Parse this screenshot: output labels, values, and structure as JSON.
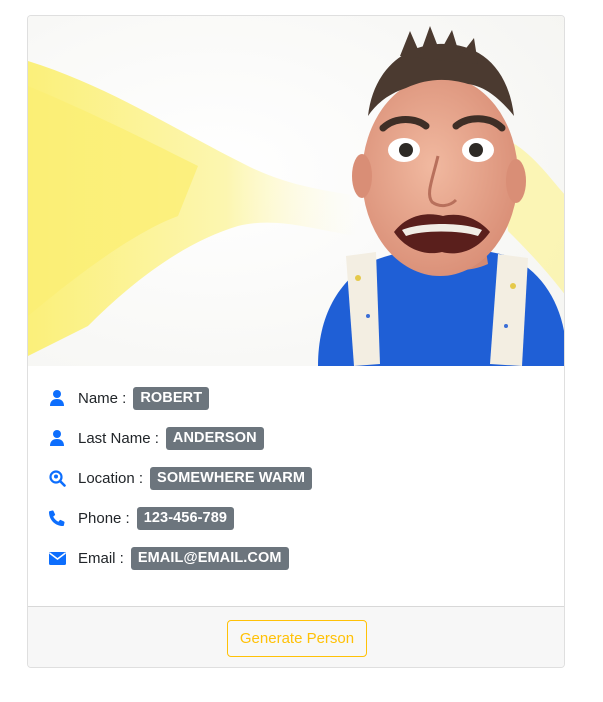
{
  "card": {
    "photo_alt": "person photo",
    "fields": [
      {
        "label": "Name :",
        "value": "ROBERT",
        "icon": "user-icon"
      },
      {
        "label": "Last Name :",
        "value": "ANDERSON",
        "icon": "user-icon"
      },
      {
        "label": "Location :",
        "value": "SOMEWHERE WARM",
        "icon": "search-location-icon"
      },
      {
        "label": "Phone :",
        "value": "123-456-789",
        "icon": "phone-icon"
      },
      {
        "label": "Email :",
        "value": "EMAIL@EMAIL.COM",
        "icon": "envelope-icon"
      }
    ],
    "button_label": "Generate Person"
  },
  "colors": {
    "icon": "#0d6efd",
    "badge": "#6c757d",
    "button": "#ffc107",
    "shirt": "#1f5fd6",
    "splash": "#fbf28a"
  }
}
